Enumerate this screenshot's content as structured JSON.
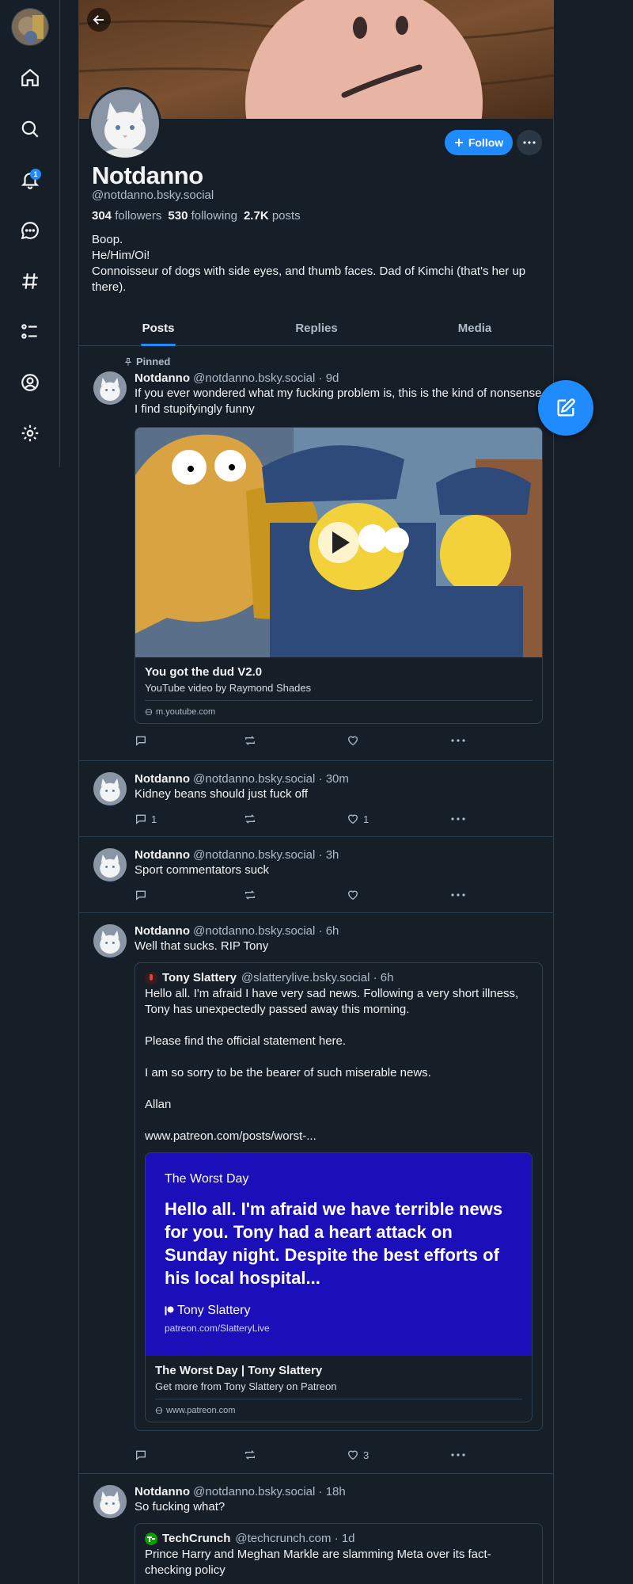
{
  "nav": {
    "items": [
      "home",
      "search",
      "notifications",
      "chat",
      "feeds",
      "lists",
      "profile",
      "settings"
    ],
    "notification_count": "1"
  },
  "profile": {
    "display_name": "Notdanno",
    "handle": "@notdanno.bsky.social",
    "followers_count": "304",
    "followers_label": "followers",
    "following_count": "530",
    "following_label": "following",
    "posts_count": "2.7K",
    "posts_label": "posts",
    "bio_lines": [
      "Boop.",
      "He/Him/Oi!",
      "Connoisseur of dogs with side eyes, and thumb faces. Dad of Kimchi (that's her up there)."
    ],
    "follow_label": "Follow"
  },
  "tabs": [
    "Posts",
    "Replies",
    "Media"
  ],
  "posts": [
    {
      "pinned_label": "Pinned",
      "name": "Notdanno",
      "meta": "@notdanno.bsky.social · 9d",
      "text": "If you ever wondered what my fucking problem is, this is the kind of nonsense I find stupifyingly funny",
      "embed": {
        "title": "You got the dud V2.0",
        "desc": "YouTube video by Raymond Shades",
        "domain": "m.youtube.com"
      },
      "replies": "",
      "reposts": "",
      "likes": ""
    },
    {
      "name": "Notdanno",
      "meta": "@notdanno.bsky.social · 30m",
      "text": "Kidney beans should just fuck off",
      "replies": "1",
      "reposts": "",
      "likes": "1"
    },
    {
      "name": "Notdanno",
      "meta": "@notdanno.bsky.social · 3h",
      "text": "Sport commentators suck",
      "replies": "",
      "reposts": "",
      "likes": ""
    },
    {
      "name": "Notdanno",
      "meta": "@notdanno.bsky.social · 6h",
      "text": "Well that sucks. RIP Tony",
      "quote": {
        "name": "Tony Slattery",
        "meta": "@slatterylive.bsky.social · 6h",
        "text": "Hello all.  I'm afraid I have very sad news.  Following a very short illness, Tony has unexpectedly passed away this morning.\n\nPlease find the official statement here.\n\nI am so sorry to be the bearer of such miserable news.\n\nAllan\n\nwww.patreon.com/posts/worst-...",
        "card": {
          "kicker": "The Worst Day",
          "headline": "Hello all. I'm afraid we have terrible news for you. Tony had a heart attack on Sunday night. Despite the best efforts of his local hospital...",
          "author": "Tony Slattery",
          "url": "patreon.com/SlatteryLive"
        },
        "embed": {
          "title": "The Worst Day | Tony Slattery",
          "desc": "Get more from Tony Slattery on Patreon",
          "domain": "www.patreon.com"
        }
      },
      "replies": "",
      "reposts": "",
      "likes": "3"
    },
    {
      "name": "Notdanno",
      "meta": "@notdanno.bsky.social · 18h",
      "text": "So fucking what?",
      "quote": {
        "name": "TechCrunch",
        "meta": "@techcrunch.com · 1d",
        "text": "Prince Harry and Meghan Markle are slamming Meta over its fact-checking policy"
      }
    }
  ],
  "colors": {
    "accent": "#208bfe",
    "background": "#161e27",
    "border": "#2e4052",
    "patreon_card": "#1a0fb8"
  }
}
